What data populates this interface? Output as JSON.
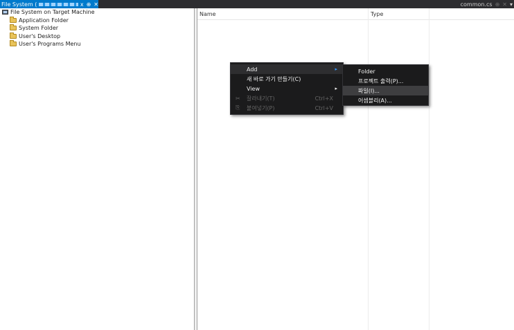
{
  "titlebar": {
    "doc_tab_label": "File System (",
    "doc_tab_suffix": "x",
    "pin_glyph": "⊕",
    "close_glyph": "✕",
    "right_tab_label": "common.cs",
    "right_tab_pin": "⊕",
    "right_tab_close": "✕",
    "dropdown_glyph": "▾"
  },
  "tree": {
    "root_label": "File System on Target Machine",
    "items": [
      {
        "label": "Application Folder"
      },
      {
        "label": "System Folder"
      },
      {
        "label": "User's Desktop"
      },
      {
        "label": "User's Programs Menu"
      }
    ]
  },
  "list": {
    "columns": [
      "Name",
      "Type"
    ]
  },
  "context_menu": {
    "items": [
      {
        "label": "Add",
        "arrow": "▸"
      },
      {
        "label": "새 바로 가기 만들기(C)"
      },
      {
        "label": "View",
        "arrow": "▸"
      },
      {
        "label": "잘라내기(T)",
        "shortcut": "Ctrl+X",
        "icon": "✂"
      },
      {
        "label": "붙여넣기(P)",
        "shortcut": "Ctrl+V",
        "icon": "⎘"
      }
    ]
  },
  "submenu": {
    "items": [
      {
        "label": "Folder"
      },
      {
        "label": "프로젝트 출력(P)..."
      },
      {
        "label": "파일(I)..."
      },
      {
        "label": "어셈블리(A)..."
      }
    ]
  },
  "colors": {
    "accent": "#007acc",
    "menu_bg": "#1b1b1c",
    "menu_highlight": "#3e3e40",
    "titlebar_bg": "#2d2d30"
  }
}
